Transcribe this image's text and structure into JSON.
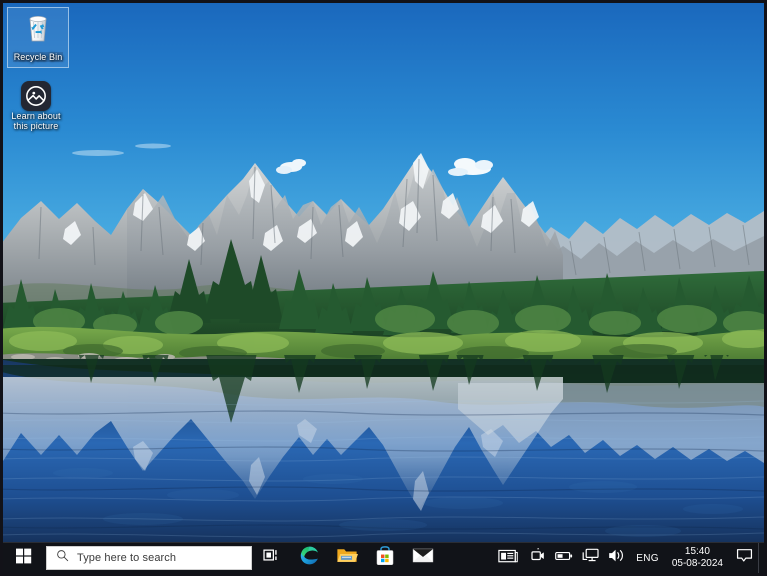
{
  "desktop": {
    "wallpaper_description": "Grand Teton mountain range with pine forest reflected in a calm blue lake",
    "colors": {
      "sky_top": "#1f74c8",
      "sky_bottom": "#4fb4e8",
      "rock": "#b9bcbd",
      "rock_shadow": "#7f868c",
      "forest_dark": "#1d4526",
      "forest_mid": "#2e6b35",
      "meadow": "#7fae4e",
      "water_deep": "#123a78",
      "water_light": "#2f6fbe",
      "taskbar": "#111318",
      "accent": "#0078d7"
    },
    "icons": [
      {
        "name": "Recycle Bin",
        "icon": "recycle-bin-icon",
        "selected": true
      },
      {
        "name": "Learn about\nthis picture",
        "line1": "Learn about",
        "line2": "this picture",
        "icon": "picture-icon",
        "selected": false
      }
    ]
  },
  "taskbar": {
    "start": {
      "label": "Start",
      "icon": "windows-logo-icon"
    },
    "search": {
      "placeholder": "Type here to search",
      "value": "",
      "icon": "search-icon"
    },
    "buttons": [
      {
        "label": "Task View",
        "icon": "task-view-icon"
      },
      {
        "label": "Microsoft Edge",
        "icon": "edge-icon"
      },
      {
        "label": "File Explorer",
        "icon": "file-explorer-icon"
      },
      {
        "label": "Microsoft Store",
        "icon": "microsoft-store-icon"
      },
      {
        "label": "Mail",
        "icon": "mail-icon"
      }
    ],
    "tray": {
      "items": [
        {
          "label": "News and interests",
          "icon": "news-icon"
        },
        {
          "label": "Meet Now",
          "icon": "meet-now-icon"
        },
        {
          "label": "Battery",
          "icon": "battery-icon"
        },
        {
          "label": "Network",
          "icon": "network-icon"
        },
        {
          "label": "Volume",
          "icon": "volume-icon"
        }
      ],
      "language": "ENG",
      "clock": {
        "time": "15:40",
        "date": "05-08-2024"
      },
      "notifications": {
        "label": "Notification center",
        "icon": "speech-bubble-icon"
      },
      "show_desktop": {
        "label": "Show desktop"
      }
    }
  }
}
